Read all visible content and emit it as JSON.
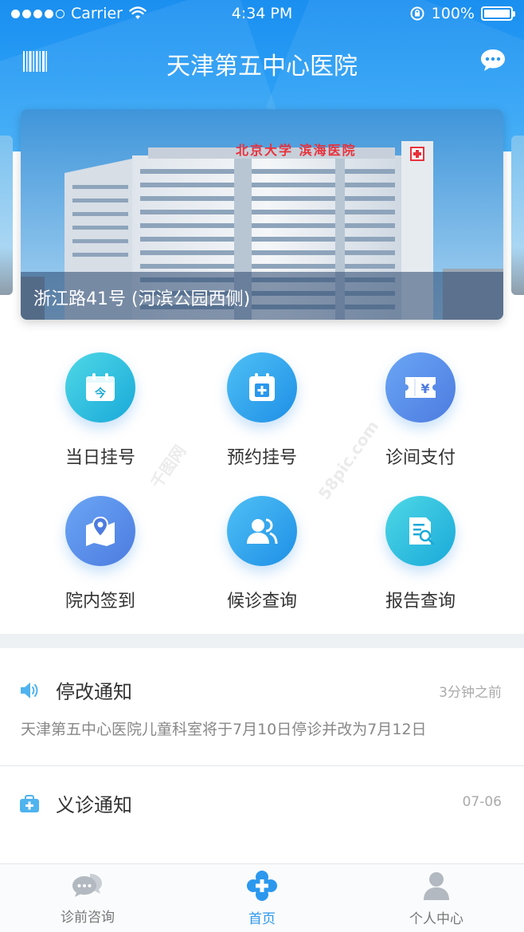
{
  "status_bar": {
    "carrier": "Carrier",
    "time": "4:34 PM",
    "battery": "100%"
  },
  "nav": {
    "title": "天津第五中心医院",
    "left_icon": "barcode-icon",
    "right_icon": "message-icon"
  },
  "banner": {
    "caption": "浙江路41号 (河滨公园西侧)",
    "sign_text": "北京大学 滨海医院"
  },
  "services": [
    {
      "label": "当日挂号",
      "icon": "calendar-today-icon",
      "color": "teal"
    },
    {
      "label": "预约挂号",
      "icon": "calendar-plus-icon",
      "color": "blue"
    },
    {
      "label": "诊间支付",
      "icon": "yen-ticket-icon",
      "color": "purple"
    },
    {
      "label": "院内签到",
      "icon": "map-pin-icon",
      "color": "purple"
    },
    {
      "label": "候诊查询",
      "icon": "people-icon",
      "color": "blue"
    },
    {
      "label": "报告查询",
      "icon": "report-search-icon",
      "color": "teal"
    }
  ],
  "watermarks": [
    "千图网",
    "58pic.com"
  ],
  "notices": [
    {
      "title": "停改通知",
      "time": "3分钟之前",
      "body": "天津第五中心医院儿童科室将于7月10日停诊并改为7月12日",
      "icon": "speaker-icon"
    },
    {
      "title": "义诊通知",
      "time": "07-06",
      "body": "",
      "icon": "medical-kit-icon"
    }
  ],
  "tabbar": [
    {
      "label": "诊前咨询",
      "icon": "chat-bubbles-icon",
      "active": false
    },
    {
      "label": "首页",
      "icon": "medical-cross-icon",
      "active": true
    },
    {
      "label": "个人中心",
      "icon": "person-icon",
      "active": false
    }
  ],
  "colors": {
    "primary": "#2b98ee",
    "teal": "#19a9d9",
    "purple": "#4d7be0",
    "sign_red": "#e8313b"
  }
}
